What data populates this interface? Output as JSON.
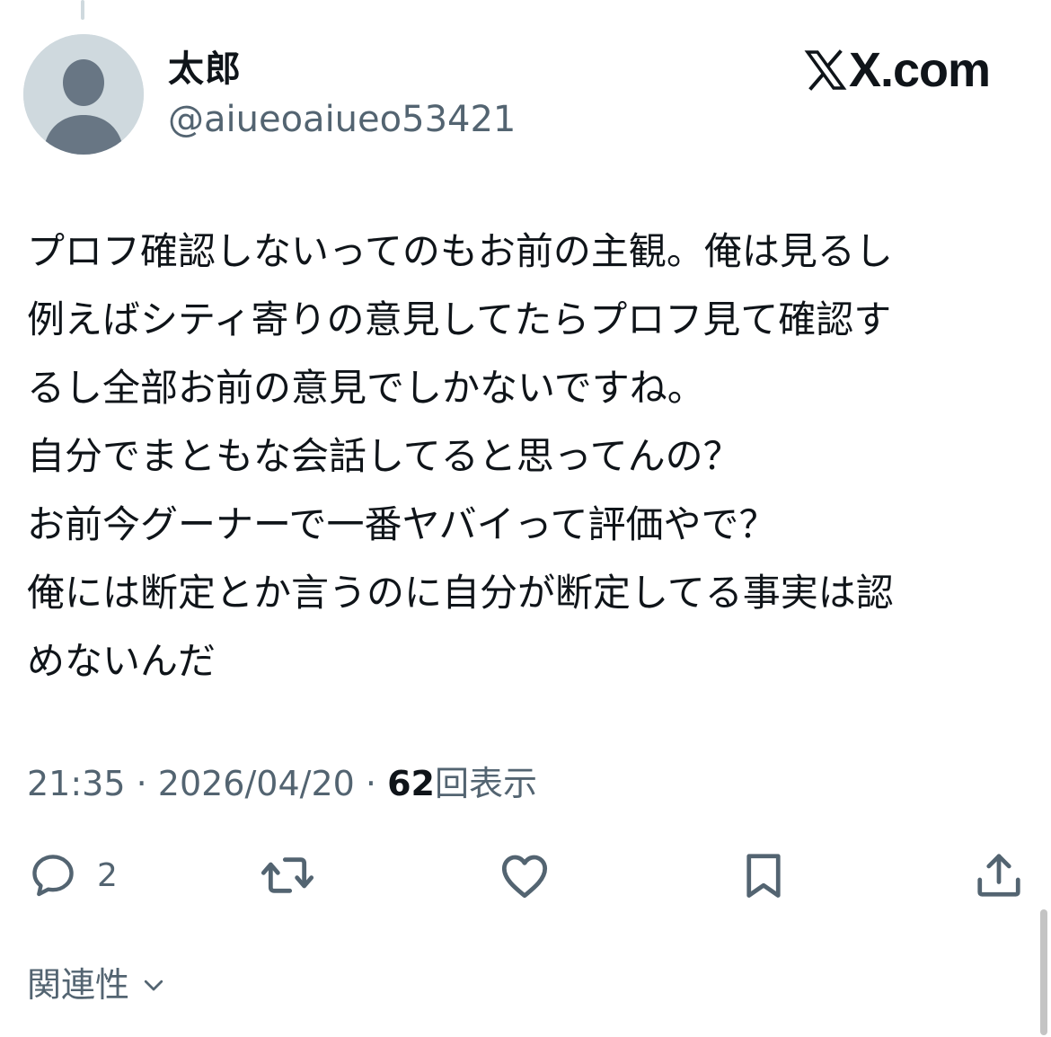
{
  "tweet": {
    "author_name": "太郎",
    "author_handle": "@aiueoaiueo53421",
    "site": "X.com",
    "body_lines": [
      "プロフ確認しないってのもお前の主観。俺は見るし",
      "例えばシティ寄りの意見してたらプロフ見て確認す",
      "るし全部お前の意見でしかないですね。",
      "自分でまともな会話してると思ってんの？",
      "お前今グーナーで一番ヤバイって評価やで？",
      "俺には断定とか言うのに自分が断定してる事実は認",
      "めないんだ"
    ],
    "time": "21:35",
    "date": "2026/04/20",
    "separator": "·",
    "views_count": "62",
    "views_label": "回表示"
  },
  "actions": {
    "reply_count": "2",
    "icons": [
      "reply-icon",
      "retweet-icon",
      "like-icon",
      "bookmark-icon",
      "share-icon"
    ]
  },
  "related": {
    "label": "関連性"
  },
  "colors": {
    "text": "#0f1419",
    "secondary": "#536471",
    "avatar_bg": "#cfd9de",
    "avatar_fg": "#687684"
  }
}
